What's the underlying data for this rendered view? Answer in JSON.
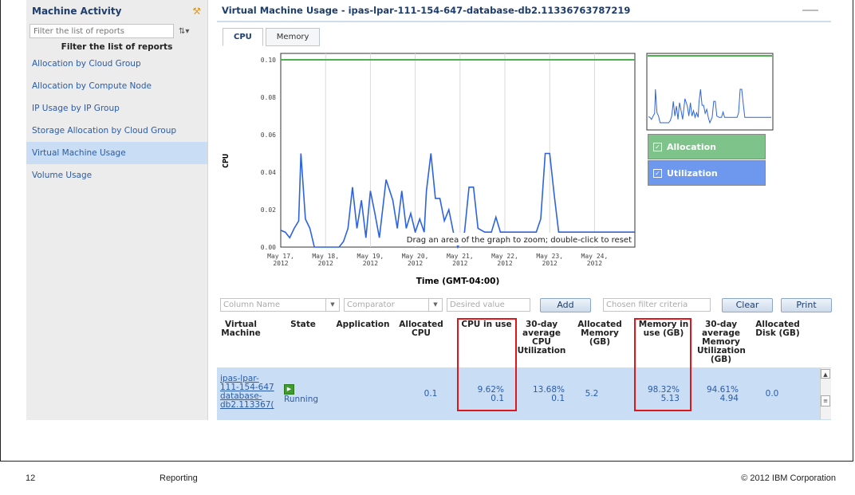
{
  "sidebar": {
    "title": "Machine Activity",
    "filter_placeholder": "Filter the list of reports",
    "filter_label": "Filter the list of reports",
    "items": [
      {
        "label": "Allocation by Cloud Group"
      },
      {
        "label": "Allocation by Compute Node"
      },
      {
        "label": "IP Usage by IP Group"
      },
      {
        "label": "Storage Allocation by Cloud Group"
      },
      {
        "label": "Virtual Machine Usage",
        "active": true
      },
      {
        "label": "Volume Usage"
      }
    ]
  },
  "main": {
    "title": "Virtual Machine Usage - ipas-lpar-111-154-647-database-db2.11336763787219",
    "tabs": [
      {
        "label": "CPU",
        "active": true
      },
      {
        "label": "Memory",
        "active": false
      }
    ],
    "legend": [
      {
        "label": "Allocation",
        "color": "#7dc38a"
      },
      {
        "label": "Utilization",
        "color": "#6d98ee"
      }
    ],
    "zoom_hint": "Drag an area of the graph to zoom; double-click to reset"
  },
  "chart_data": {
    "type": "line",
    "xlabel": "Time (GMT-04:00)",
    "ylabel": "CPU",
    "ylim": [
      0,
      0.1
    ],
    "yticks": [
      "0.00",
      "0.02",
      "0.04",
      "0.06",
      "0.08",
      "0.10"
    ],
    "xticks": [
      [
        "May 17,",
        "2012"
      ],
      [
        "May 18,",
        "2012"
      ],
      [
        "May 19,",
        "2012"
      ],
      [
        "May 20,",
        "2012"
      ],
      [
        "May 21,",
        "2012"
      ],
      [
        "May 22,",
        "2012"
      ],
      [
        "May 23,",
        "2012"
      ],
      [
        "May 24,",
        "2012"
      ]
    ],
    "x_range_days": [
      0,
      7.9
    ],
    "series": [
      {
        "name": "Allocation",
        "color": "#4caf50",
        "points": [
          [
            0,
            0.1
          ],
          [
            7.9,
            0.1
          ]
        ]
      },
      {
        "name": "Utilization",
        "color": "#2d63e0",
        "points": [
          [
            0,
            0.009
          ],
          [
            0.1,
            0.008
          ],
          [
            0.2,
            0.005
          ],
          [
            0.3,
            0.01
          ],
          [
            0.4,
            0.014
          ],
          [
            0.45,
            0.05
          ],
          [
            0.55,
            0.015
          ],
          [
            0.65,
            0.01
          ],
          [
            0.75,
            0.0
          ],
          [
            1.0,
            0.0
          ],
          [
            1.15,
            0.0
          ],
          [
            1.3,
            0.0
          ],
          [
            1.4,
            0.003
          ],
          [
            1.5,
            0.01
          ],
          [
            1.6,
            0.032
          ],
          [
            1.7,
            0.01
          ],
          [
            1.8,
            0.025
          ],
          [
            1.9,
            0.005
          ],
          [
            2.0,
            0.03
          ],
          [
            2.1,
            0.018
          ],
          [
            2.2,
            0.005
          ],
          [
            2.35,
            0.036
          ],
          [
            2.5,
            0.025
          ],
          [
            2.6,
            0.01
          ],
          [
            2.7,
            0.03
          ],
          [
            2.8,
            0.01
          ],
          [
            2.9,
            0.018
          ],
          [
            3.0,
            0.008
          ],
          [
            3.1,
            0.015
          ],
          [
            3.2,
            0.008
          ],
          [
            3.25,
            0.03
          ],
          [
            3.35,
            0.05
          ],
          [
            3.45,
            0.026
          ],
          [
            3.55,
            0.026
          ],
          [
            3.65,
            0.014
          ],
          [
            3.75,
            0.02
          ],
          [
            3.85,
            0.008
          ],
          [
            3.95,
            0.0
          ],
          [
            4.1,
            0.008
          ],
          [
            4.2,
            0.032
          ],
          [
            4.3,
            0.032
          ],
          [
            4.4,
            0.01
          ],
          [
            4.55,
            0.008
          ],
          [
            4.7,
            0.008
          ],
          [
            4.8,
            0.016
          ],
          [
            4.9,
            0.008
          ],
          [
            5.2,
            0.008
          ],
          [
            5.5,
            0.008
          ],
          [
            5.7,
            0.008
          ],
          [
            5.8,
            0.015
          ],
          [
            5.9,
            0.05
          ],
          [
            6.0,
            0.05
          ],
          [
            6.1,
            0.028
          ],
          [
            6.2,
            0.008
          ],
          [
            6.5,
            0.008
          ],
          [
            7.0,
            0.008
          ],
          [
            7.5,
            0.008
          ],
          [
            7.9,
            0.008
          ]
        ]
      }
    ],
    "overview": {
      "allocation_y": 0.1
    }
  },
  "filterbar": {
    "column_placeholder": "Column Name",
    "comparator_placeholder": "Comparator",
    "value_placeholder": "Desired value",
    "add_label": "Add",
    "criteria_placeholder": "Chosen filter criteria",
    "clear_label": "Clear",
    "print_label": "Print"
  },
  "table": {
    "headers": [
      "Virtual\nMachine",
      "State",
      "Application",
      "Allocated\nCPU",
      "CPU in use",
      "30-day\naverage\nCPU\nUtilization",
      "Allocated\nMemory\n(GB)",
      "Memory in\nuse (GB)",
      "30-day\naverage\nMemory\nUtilization\n(GB)",
      "Allocated\nDisk (GB)"
    ],
    "row": {
      "vm": "ipas-lpar-\n111-154-647\ndatabase-\ndb2.113367(",
      "state": "Running",
      "application": "",
      "alloc_cpu": "0.1",
      "cpu_in_use": "9.62%\n0.1",
      "avg_cpu": "13.68%\n0.1",
      "alloc_mem": "5.2",
      "mem_in_use": "98.32%\n5.13",
      "avg_mem": "94.61%\n4.94",
      "alloc_disk": "0.0"
    }
  },
  "footer": {
    "page": "12",
    "section": "Reporting",
    "copyright": "© 2012 IBM Corporation"
  }
}
